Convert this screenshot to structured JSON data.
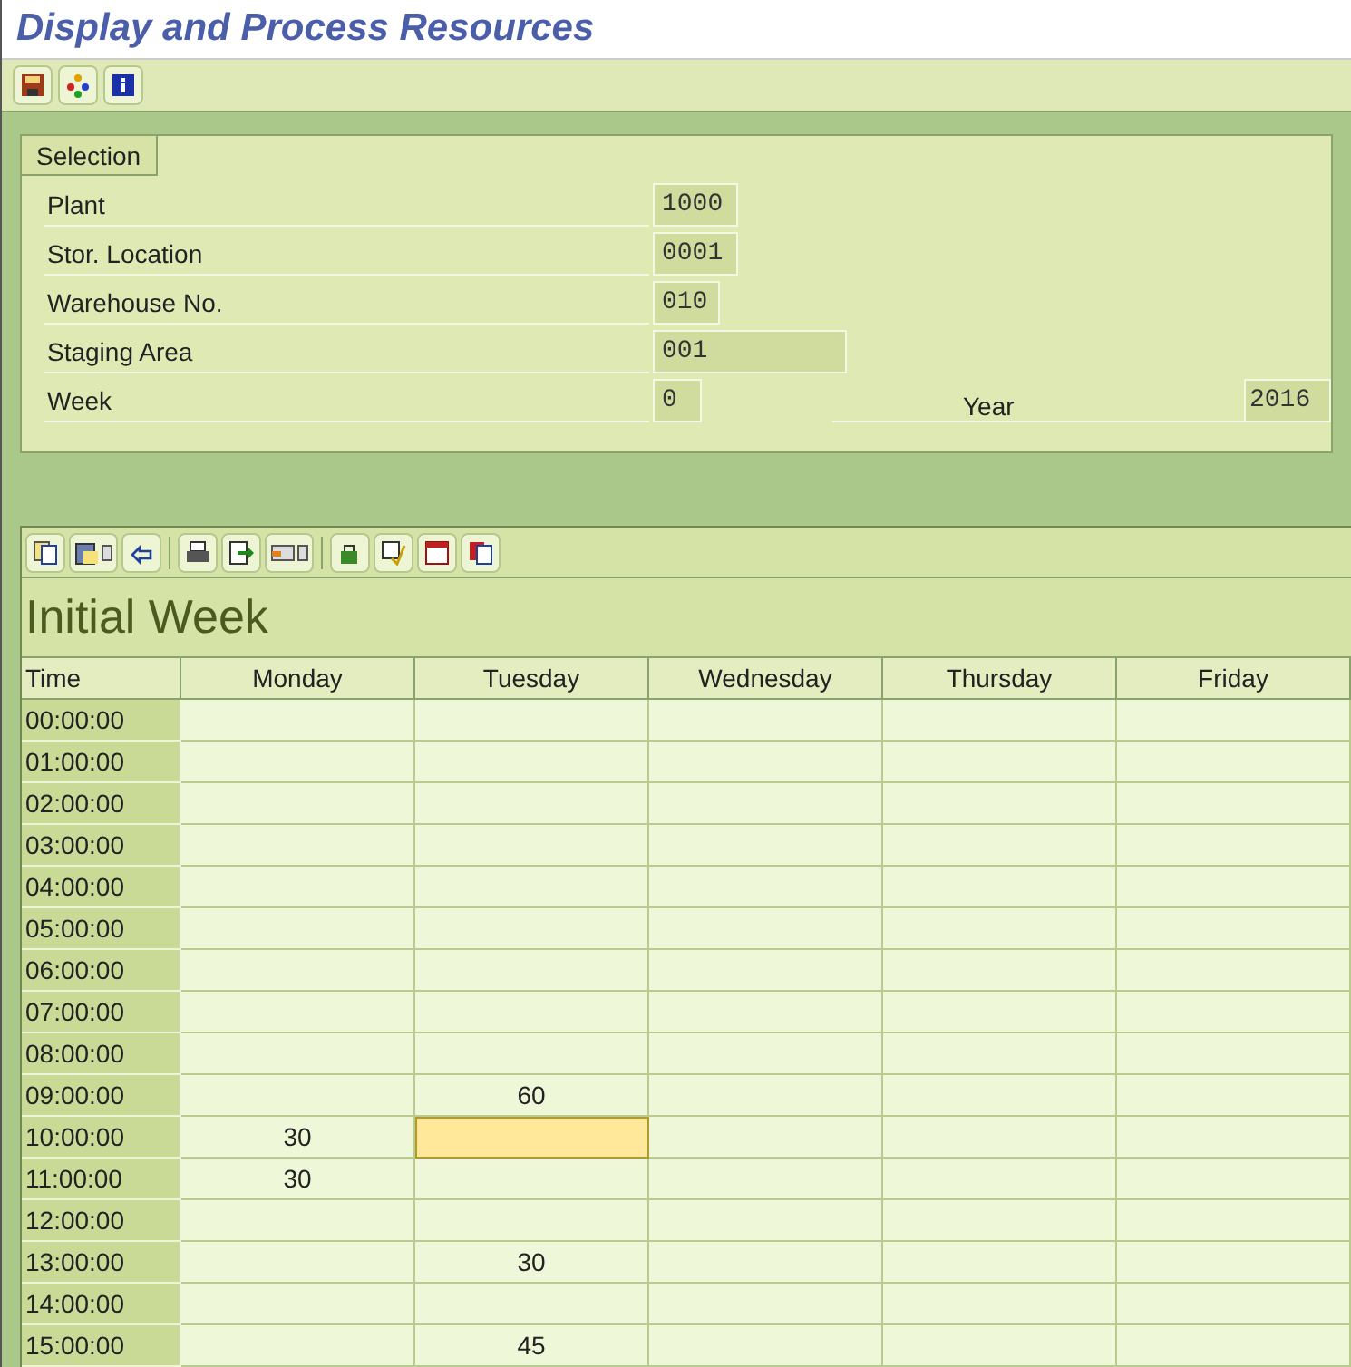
{
  "window": {
    "title": "Display and Process Resources"
  },
  "selection": {
    "title": "Selection",
    "fields": [
      {
        "label": "Plant",
        "value": "1000"
      },
      {
        "label": "Stor. Location",
        "value": "0001"
      },
      {
        "label": "Warehouse No.",
        "value": "010"
      },
      {
        "label": "Staging Area",
        "value": "001"
      },
      {
        "label": "Week",
        "value": "0"
      }
    ],
    "year": {
      "label": "Year",
      "value": "2016"
    }
  },
  "table": {
    "title": "Initial Week",
    "columns": [
      "Time",
      "Monday",
      "Tuesday",
      "Wednesday",
      "Thursday",
      "Friday"
    ],
    "rows": [
      {
        "cells": [
          {
            "text": "00:00:00"
          },
          {
            "text": "",
            "selected": false
          },
          {
            "text": "",
            "selected": false
          },
          {
            "text": "",
            "selected": false
          },
          {
            "text": "",
            "selected": false
          },
          {
            "text": "",
            "selected": false
          }
        ]
      },
      {
        "cells": [
          {
            "text": "01:00:00"
          },
          {
            "text": "",
            "selected": false
          },
          {
            "text": "",
            "selected": false
          },
          {
            "text": "",
            "selected": false
          },
          {
            "text": "",
            "selected": false
          },
          {
            "text": "",
            "selected": false
          }
        ]
      },
      {
        "cells": [
          {
            "text": "02:00:00"
          },
          {
            "text": "",
            "selected": false
          },
          {
            "text": "",
            "selected": false
          },
          {
            "text": "",
            "selected": false
          },
          {
            "text": "",
            "selected": false
          },
          {
            "text": "",
            "selected": false
          }
        ]
      },
      {
        "cells": [
          {
            "text": "03:00:00"
          },
          {
            "text": "",
            "selected": false
          },
          {
            "text": "",
            "selected": false
          },
          {
            "text": "",
            "selected": false
          },
          {
            "text": "",
            "selected": false
          },
          {
            "text": "",
            "selected": false
          }
        ]
      },
      {
        "cells": [
          {
            "text": "04:00:00"
          },
          {
            "text": "",
            "selected": false
          },
          {
            "text": "",
            "selected": false
          },
          {
            "text": "",
            "selected": false
          },
          {
            "text": "",
            "selected": false
          },
          {
            "text": "",
            "selected": false
          }
        ]
      },
      {
        "cells": [
          {
            "text": "05:00:00"
          },
          {
            "text": "",
            "selected": false
          },
          {
            "text": "",
            "selected": false
          },
          {
            "text": "",
            "selected": false
          },
          {
            "text": "",
            "selected": false
          },
          {
            "text": "",
            "selected": false
          }
        ]
      },
      {
        "cells": [
          {
            "text": "06:00:00"
          },
          {
            "text": "",
            "selected": false
          },
          {
            "text": "",
            "selected": false
          },
          {
            "text": "",
            "selected": false
          },
          {
            "text": "",
            "selected": false
          },
          {
            "text": "",
            "selected": false
          }
        ]
      },
      {
        "cells": [
          {
            "text": "07:00:00"
          },
          {
            "text": "",
            "selected": false
          },
          {
            "text": "",
            "selected": false
          },
          {
            "text": "",
            "selected": false
          },
          {
            "text": "",
            "selected": false
          },
          {
            "text": "",
            "selected": false
          }
        ]
      },
      {
        "cells": [
          {
            "text": "08:00:00"
          },
          {
            "text": "",
            "selected": false
          },
          {
            "text": "",
            "selected": false
          },
          {
            "text": "",
            "selected": false
          },
          {
            "text": "",
            "selected": false
          },
          {
            "text": "",
            "selected": false
          }
        ]
      },
      {
        "cells": [
          {
            "text": "09:00:00"
          },
          {
            "text": "",
            "selected": false
          },
          {
            "text": "60",
            "selected": false
          },
          {
            "text": "",
            "selected": false
          },
          {
            "text": "",
            "selected": false
          },
          {
            "text": "",
            "selected": false
          }
        ]
      },
      {
        "cells": [
          {
            "text": "10:00:00"
          },
          {
            "text": "30",
            "selected": false
          },
          {
            "text": "",
            "selected": true
          },
          {
            "text": "",
            "selected": false
          },
          {
            "text": "",
            "selected": false
          },
          {
            "text": "",
            "selected": false
          }
        ]
      },
      {
        "cells": [
          {
            "text": "11:00:00"
          },
          {
            "text": "30",
            "selected": false
          },
          {
            "text": "",
            "selected": false
          },
          {
            "text": "",
            "selected": false
          },
          {
            "text": "",
            "selected": false
          },
          {
            "text": "",
            "selected": false
          }
        ]
      },
      {
        "cells": [
          {
            "text": "12:00:00"
          },
          {
            "text": "",
            "selected": false
          },
          {
            "text": "",
            "selected": false
          },
          {
            "text": "",
            "selected": false
          },
          {
            "text": "",
            "selected": false
          },
          {
            "text": "",
            "selected": false
          }
        ]
      },
      {
        "cells": [
          {
            "text": "13:00:00"
          },
          {
            "text": "",
            "selected": false
          },
          {
            "text": "30",
            "selected": false
          },
          {
            "text": "",
            "selected": false
          },
          {
            "text": "",
            "selected": false
          },
          {
            "text": "",
            "selected": false
          }
        ]
      },
      {
        "cells": [
          {
            "text": "14:00:00"
          },
          {
            "text": "",
            "selected": false
          },
          {
            "text": "",
            "selected": false
          },
          {
            "text": "",
            "selected": false
          },
          {
            "text": "",
            "selected": false
          },
          {
            "text": "",
            "selected": false
          }
        ]
      },
      {
        "cells": [
          {
            "text": "15:00:00"
          },
          {
            "text": "",
            "selected": false
          },
          {
            "text": "45",
            "selected": false
          },
          {
            "text": "",
            "selected": false
          },
          {
            "text": "",
            "selected": false
          },
          {
            "text": "",
            "selected": false
          }
        ]
      }
    ]
  }
}
